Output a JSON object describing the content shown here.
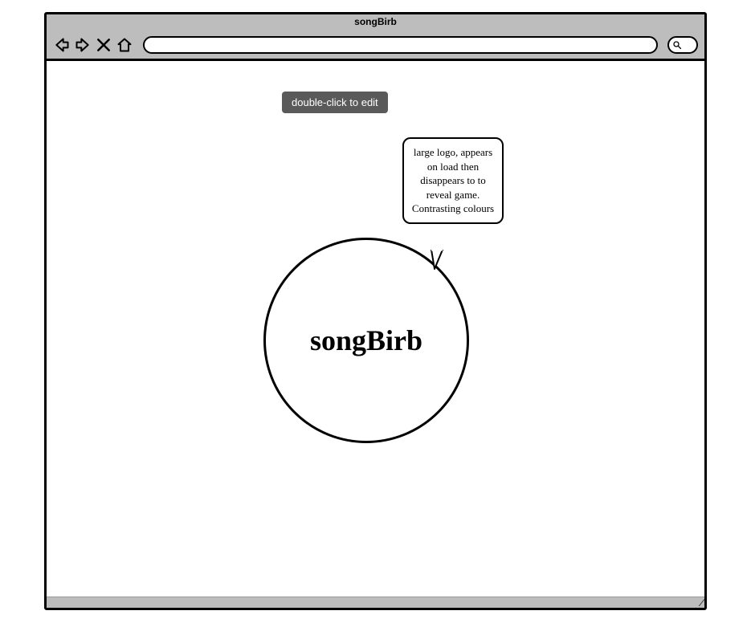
{
  "browser": {
    "title": "songBirb",
    "url": ""
  },
  "tooltip": {
    "text": "double-click to edit"
  },
  "logo": {
    "text": "songBirb"
  },
  "annotation": {
    "text": "large logo, appears on load then disappears to to reveal game. Contrasting colours"
  }
}
